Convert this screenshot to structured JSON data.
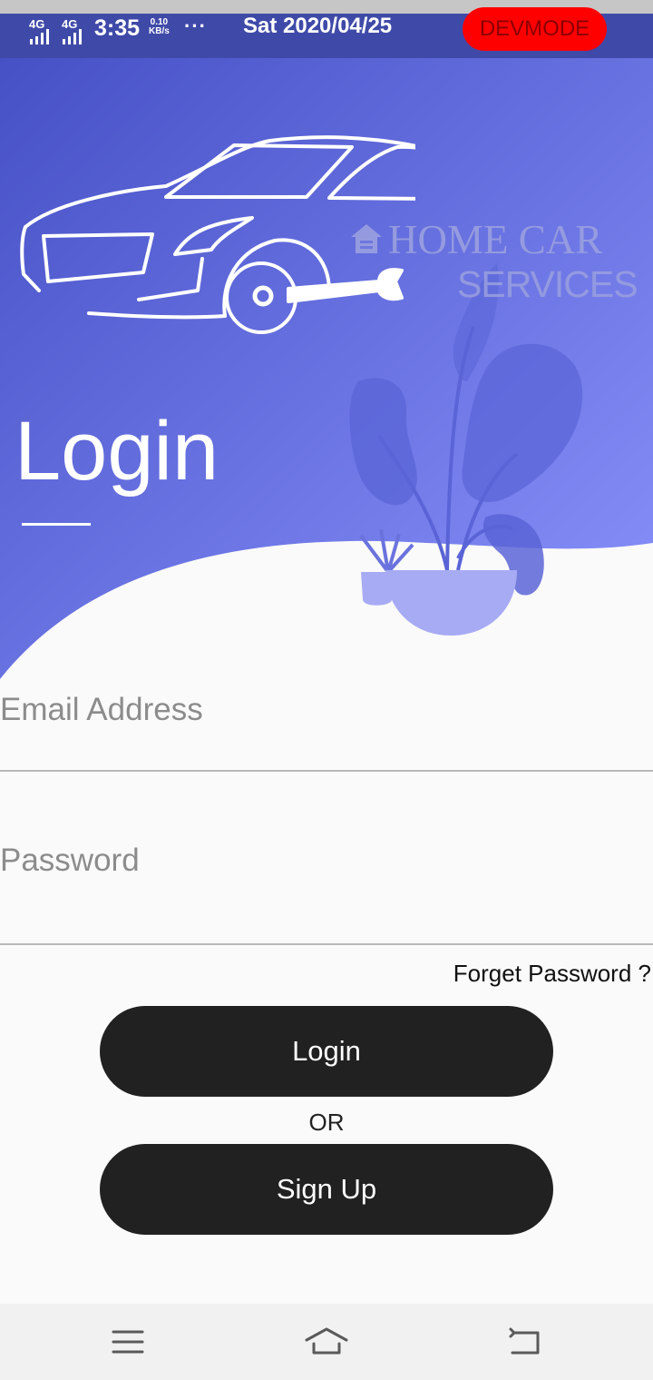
{
  "status_bar": {
    "network_1": "4G",
    "network_2": "4G",
    "time": "3:35",
    "speed_value": "0.10",
    "speed_unit": "KB/s",
    "overflow": "···",
    "date": "Sat 2020/04/25",
    "dev_badge": "DEVMODE"
  },
  "logo": {
    "line1": "HOME CAR",
    "line2": "SERVICES"
  },
  "page": {
    "title": "Login"
  },
  "form": {
    "email_placeholder": "Email Address",
    "password_placeholder": "Password",
    "forgot_link": "Forget Password ?",
    "login_button": "Login",
    "separator": "OR",
    "signup_button": "Sign Up"
  },
  "nav_bar": {
    "menu_icon": "menu-icon",
    "home_icon": "home-icon",
    "back_icon": "back-icon"
  },
  "colors": {
    "gradient_start": "#4651c6",
    "gradient_end": "#8a92fb",
    "plant": "#5a64d6",
    "pot": "#a7abf4",
    "button": "#212121",
    "dev_badge": "#ff0000"
  }
}
